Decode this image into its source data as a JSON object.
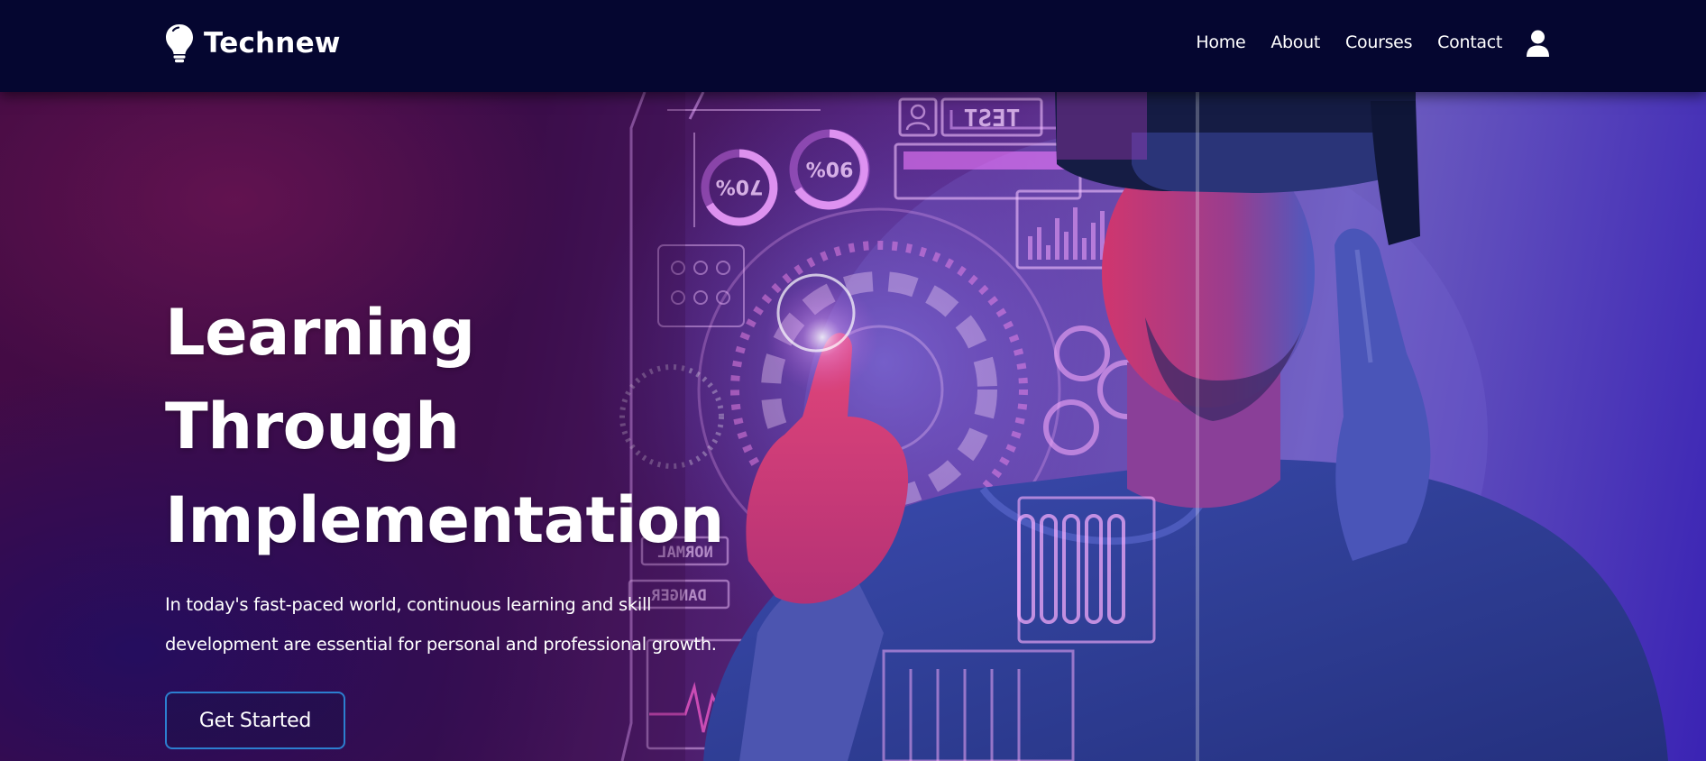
{
  "brand": {
    "name": "Technew",
    "icon": "lightbulb-icon"
  },
  "nav": {
    "items": [
      {
        "label": "Home"
      },
      {
        "label": "About"
      },
      {
        "label": "Courses"
      },
      {
        "label": "Contact"
      }
    ],
    "user_icon": "user-icon"
  },
  "hero": {
    "title_line1": "Learning Through",
    "title_line2": "Implementation",
    "text_line1": "In today's fast-paced world, continuous learning and skill",
    "text_line2": "development are essential for personal and professional growth.",
    "cta_label": "Get Started",
    "image_texts": {
      "test": "TEST",
      "pct_a": "70%",
      "pct_b": "90%",
      "normal": "NORMAL",
      "danger": "DANGER"
    }
  },
  "colors": {
    "navbar_bg": "#050630",
    "button_border": "#2c7fd0",
    "text": "#ffffff"
  }
}
